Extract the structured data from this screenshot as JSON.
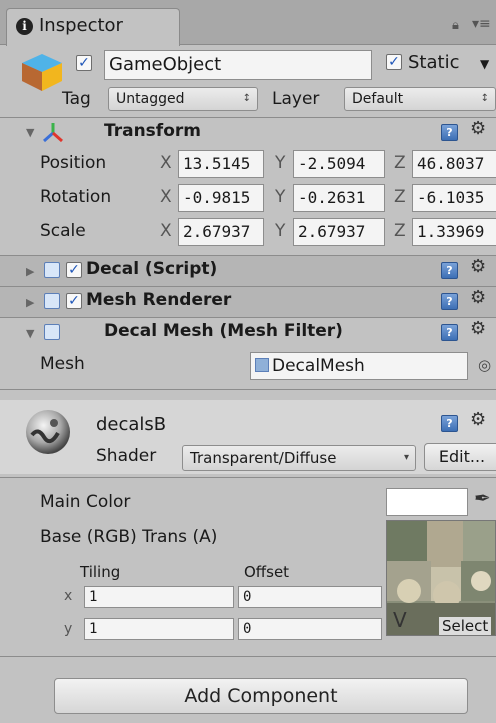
{
  "inspector": {
    "tab_title": "Inspector",
    "lock_icon": "lock-icon",
    "menu_icon": "menu-icon"
  },
  "gameobject": {
    "name": "GameObject",
    "active": true,
    "static_label": "Static",
    "static_checked": true,
    "tag_label": "Tag",
    "tag_value": "Untagged",
    "layer_label": "Layer",
    "layer_value": "Default"
  },
  "transform": {
    "title": "Transform",
    "position": {
      "label": "Position",
      "x": "13.5145",
      "y": "-2.5094",
      "z": "46.8037"
    },
    "rotation": {
      "label": "Rotation",
      "x": "-0.9815",
      "y": "-0.2631",
      "z": "-6.1035"
    },
    "scale": {
      "label": "Scale",
      "x": "2.67937",
      "y": "2.67937",
      "z": "1.33969"
    },
    "axis_x": "X",
    "axis_y": "Y",
    "axis_z": "Z"
  },
  "decal_script": {
    "title": "Decal (Script)",
    "enabled": true
  },
  "mesh_renderer": {
    "title": "Mesh Renderer",
    "enabled": true
  },
  "mesh_filter": {
    "title": "Decal Mesh (Mesh Filter)",
    "mesh_label": "Mesh",
    "mesh_value": "DecalMesh"
  },
  "material": {
    "name": "decalsB",
    "shader_label": "Shader",
    "shader_value": "Transparent/Diffuse",
    "edit_label": "Edit...",
    "main_color_label": "Main Color",
    "main_color": "#ffffff",
    "base_label": "Base (RGB) Trans (A)",
    "tiling_label": "Tiling",
    "offset_label": "Offset",
    "x_label": "x",
    "y_label": "y",
    "tiling_x": "1",
    "tiling_y": "1",
    "offset_x": "0",
    "offset_y": "0",
    "select_label": "Select"
  },
  "add_component_label": "Add Component"
}
